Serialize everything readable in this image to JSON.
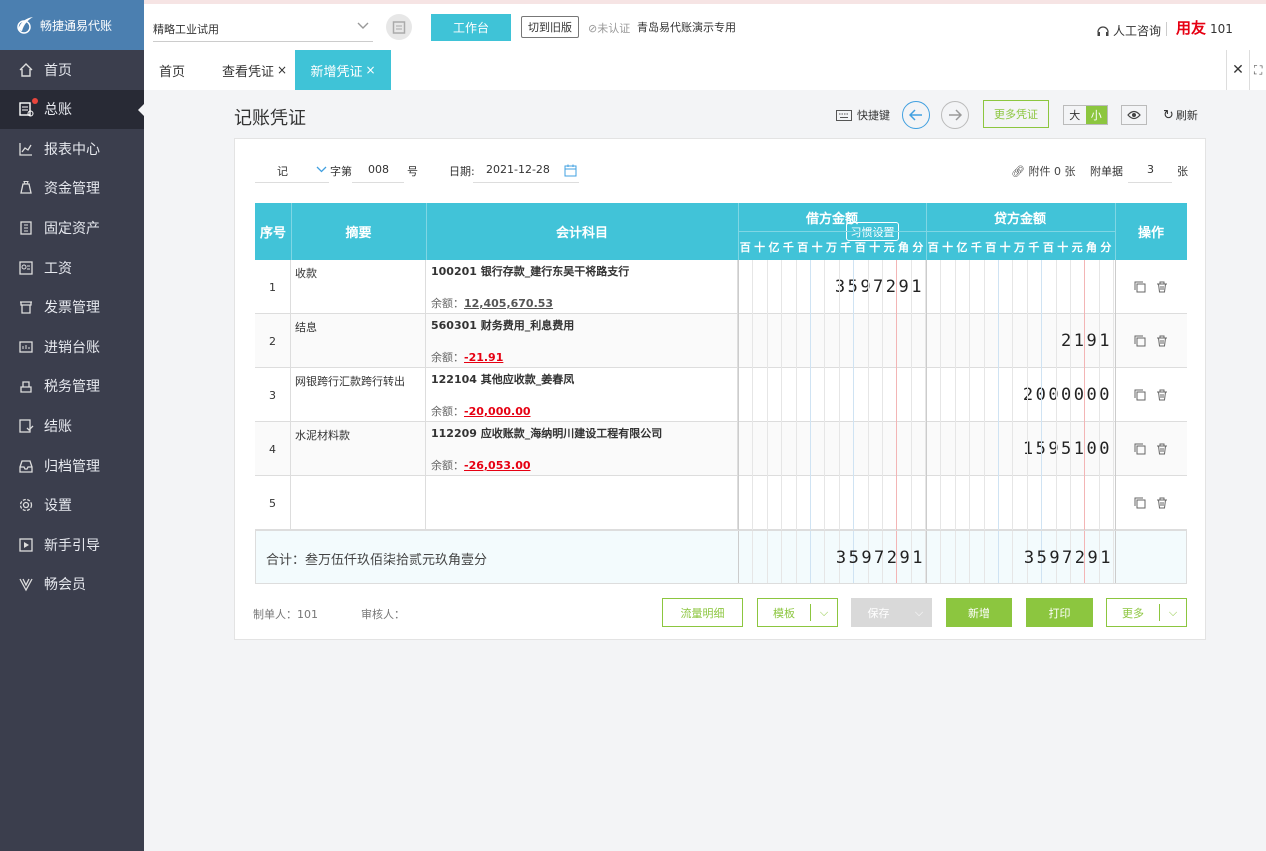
{
  "app": {
    "logo_text": "畅捷通易代账",
    "company": "精略工业试用",
    "workbench": "工作台",
    "switch_old": "切到旧版",
    "cert_status": "未认证",
    "demo_account": "青岛易代账演示专用",
    "consult": "人工咨询",
    "brand": "用友",
    "user": "101"
  },
  "sidebar": {
    "items": [
      {
        "label": "首页",
        "icon": "home-icon"
      },
      {
        "label": "总账",
        "icon": "ledger-icon"
      },
      {
        "label": "报表中心",
        "icon": "chart-icon"
      },
      {
        "label": "资金管理",
        "icon": "money-bag-icon"
      },
      {
        "label": "固定资产",
        "icon": "building-icon"
      },
      {
        "label": "工资",
        "icon": "salary-icon"
      },
      {
        "label": "发票管理",
        "icon": "invoice-icon"
      },
      {
        "label": "进销台账",
        "icon": "inventory-icon"
      },
      {
        "label": "税务管理",
        "icon": "tax-icon"
      },
      {
        "label": "结账",
        "icon": "checkout-icon"
      },
      {
        "label": "归档管理",
        "icon": "archive-icon"
      },
      {
        "label": "设置",
        "icon": "gear-icon"
      },
      {
        "label": "新手引导",
        "icon": "guide-icon"
      },
      {
        "label": "畅会员",
        "icon": "vip-icon"
      }
    ]
  },
  "tabs": [
    {
      "label": "首页"
    },
    {
      "label": "查看凭证"
    },
    {
      "label": "新增凭证"
    }
  ],
  "page": {
    "title": "记账凭证",
    "shortcut": "快捷键",
    "more_voucher": "更多凭证",
    "size_large": "大",
    "size_small": "小",
    "refresh": "刷新"
  },
  "voucher": {
    "type": "记",
    "word_label": "字第",
    "number": "008",
    "number_suffix": "号",
    "date_label": "日期:",
    "date": "2021-12-28",
    "attachment": "附件 0 张",
    "doc_label": "附单据",
    "doc_count": "3",
    "doc_suffix": "张"
  },
  "table": {
    "headers": {
      "seq": "序号",
      "summary": "摘要",
      "account": "会计科目",
      "habit": "习惯设置",
      "debit": "借方金额",
      "credit": "贷方金额",
      "ops": "操作"
    },
    "digit_units": [
      "百",
      "十",
      "亿",
      "千",
      "百",
      "十",
      "万",
      "千",
      "百",
      "十",
      "元",
      "角",
      "分"
    ],
    "balance_label": "余额：",
    "rows": [
      {
        "no": "1",
        "summary": "收款",
        "account": "100201 银行存款_建行东吴干将路支行",
        "balance": "12,405,670.53",
        "negative": false,
        "debit": "3597291",
        "credit": ""
      },
      {
        "no": "2",
        "summary": "结息",
        "account": "560301 财务费用_利息费用",
        "balance": "-21.91",
        "negative": true,
        "debit": "",
        "credit": "2191"
      },
      {
        "no": "3",
        "summary": "网银跨行汇款跨行转出",
        "account": "122104 其他应收款_姜春凤",
        "balance": "-20,000.00",
        "negative": true,
        "debit": "",
        "credit": "2000000"
      },
      {
        "no": "4",
        "summary": "水泥材料款",
        "account": "112209 应收账款_海纳明川建设工程有限公司",
        "balance": "-26,053.00",
        "negative": true,
        "debit": "",
        "credit": "1595100"
      },
      {
        "no": "5",
        "summary": "",
        "account": "",
        "balance": "",
        "negative": false,
        "debit": "",
        "credit": ""
      }
    ],
    "total": {
      "label": "合计：叁万伍仟玖佰柒拾贰元玖角壹分",
      "debit": "3597291",
      "credit": "3597291"
    }
  },
  "footer": {
    "maker": "制单人：101",
    "reviewer": "审核人：",
    "flow": "流量明细",
    "template": "模板",
    "save": "保存",
    "add": "新增",
    "print": "打印",
    "more": "更多"
  },
  "colors": {
    "accent": "#3fc3d7",
    "green": "#8cc63f",
    "sidebar": "#3b3e4d",
    "negative": "#e60012"
  }
}
